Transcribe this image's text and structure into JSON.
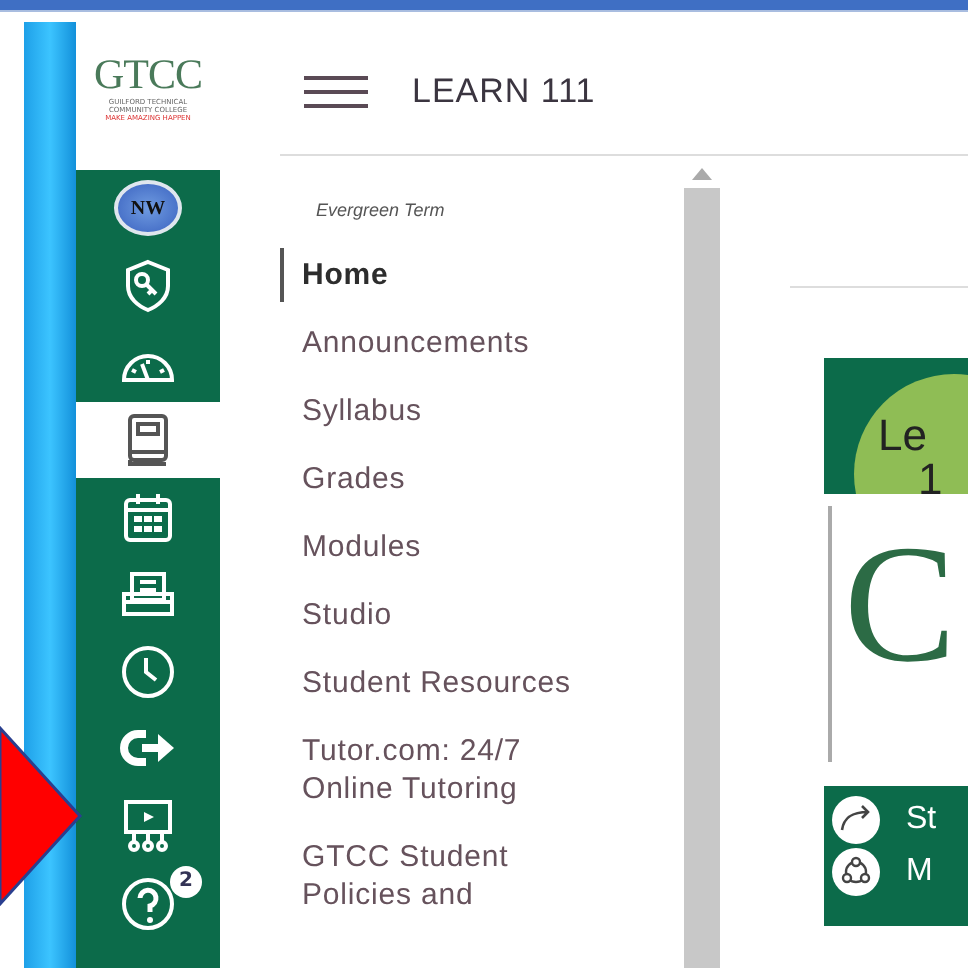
{
  "logo": {
    "name": "GTCC",
    "subtitle": "GUILFORD TECHNICAL COMMUNITY COLLEGE",
    "tagline": "MAKE AMAZING HAPPEN"
  },
  "global_nav": [
    {
      "kind": "account",
      "label": "NW",
      "selected": false
    },
    {
      "kind": "admin",
      "selected": false
    },
    {
      "kind": "dashboard",
      "selected": false
    },
    {
      "kind": "courses",
      "selected": true
    },
    {
      "kind": "calendar",
      "selected": false
    },
    {
      "kind": "inbox",
      "selected": false
    },
    {
      "kind": "history",
      "selected": false
    },
    {
      "kind": "logout",
      "selected": false
    },
    {
      "kind": "studio",
      "selected": false
    },
    {
      "kind": "help",
      "badge": "2",
      "selected": false
    }
  ],
  "header": {
    "title": "LEARN 111"
  },
  "course_nav": {
    "term": "Evergreen Term",
    "items": [
      {
        "label": "Home",
        "selected": true
      },
      {
        "label": "Announcements",
        "selected": false
      },
      {
        "label": "Syllabus",
        "selected": false
      },
      {
        "label": "Grades",
        "selected": false
      },
      {
        "label": "Modules",
        "selected": false
      },
      {
        "label": "Studio",
        "selected": false
      },
      {
        "label": "Student Resources",
        "selected": false
      },
      {
        "label": "Tutor.com: 24/7 Online Tutoring",
        "selected": false
      },
      {
        "label": "GTCC Student Policies and",
        "selected": false
      }
    ]
  },
  "content": {
    "circle_line_1": "Le",
    "circle_line_2": "1",
    "logo_letter": "C",
    "links": [
      {
        "kind": "share",
        "label": "St"
      },
      {
        "kind": "group",
        "label": "M"
      }
    ]
  }
}
